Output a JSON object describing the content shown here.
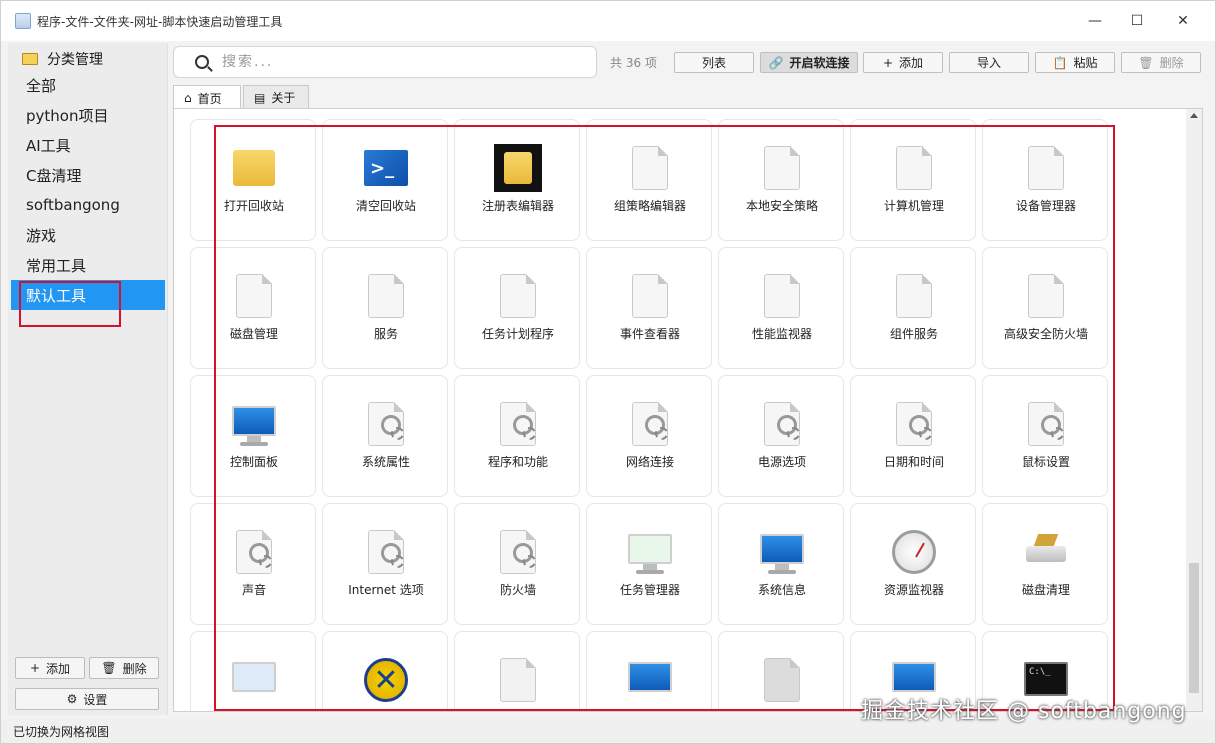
{
  "window": {
    "title": "程序-文件-文件夹-网址-脚本快速启动管理工具"
  },
  "sidebar": {
    "header": "分类管理",
    "items": [
      {
        "label": "全部"
      },
      {
        "label": "python项目"
      },
      {
        "label": "AI工具"
      },
      {
        "label": "C盘清理"
      },
      {
        "label": "softbangong"
      },
      {
        "label": "游戏"
      },
      {
        "label": "常用工具"
      },
      {
        "label": "默认工具",
        "active": true
      }
    ],
    "add_label": "添加",
    "delete_label": "删除",
    "settings_label": "设置"
  },
  "toolbar": {
    "search_placeholder": "搜索...",
    "count": "共 36 项",
    "list_label": "列表",
    "soft_link_label": "开启软连接",
    "add_label": "添加",
    "import_label": "导入",
    "paste_label": "粘贴",
    "delete_label": "删除"
  },
  "tabs": [
    {
      "label": "首页",
      "active": true
    },
    {
      "label": "关于"
    }
  ],
  "items": [
    {
      "label": "打开回收站",
      "icon": "folder-icon"
    },
    {
      "label": "清空回收站",
      "icon": "powershell-icon"
    },
    {
      "label": "注册表编辑器",
      "icon": "folder-dark-icon"
    },
    {
      "label": "组策略编辑器",
      "icon": "document-icon"
    },
    {
      "label": "本地安全策略",
      "icon": "document-icon"
    },
    {
      "label": "计算机管理",
      "icon": "document-icon"
    },
    {
      "label": "设备管理器",
      "icon": "document-icon"
    },
    {
      "label": "磁盘管理",
      "icon": "document-icon"
    },
    {
      "label": "服务",
      "icon": "document-icon"
    },
    {
      "label": "任务计划程序",
      "icon": "document-icon"
    },
    {
      "label": "事件查看器",
      "icon": "document-icon"
    },
    {
      "label": "性能监视器",
      "icon": "document-icon"
    },
    {
      "label": "组件服务",
      "icon": "document-icon"
    },
    {
      "label": "高级安全防火墙",
      "icon": "document-icon"
    },
    {
      "label": "控制面板",
      "icon": "control-panel-icon"
    },
    {
      "label": "系统属性",
      "icon": "settings-doc-icon"
    },
    {
      "label": "程序和功能",
      "icon": "settings-doc-icon"
    },
    {
      "label": "网络连接",
      "icon": "settings-doc-icon"
    },
    {
      "label": "电源选项",
      "icon": "settings-doc-icon"
    },
    {
      "label": "日期和时间",
      "icon": "settings-doc-icon"
    },
    {
      "label": "鼠标设置",
      "icon": "settings-doc-icon"
    },
    {
      "label": "声音",
      "icon": "settings-doc-icon"
    },
    {
      "label": "Internet 选项",
      "icon": "settings-doc-icon"
    },
    {
      "label": "防火墙",
      "icon": "settings-doc-icon"
    },
    {
      "label": "任务管理器",
      "icon": "task-manager-icon"
    },
    {
      "label": "系统信息",
      "icon": "system-info-icon"
    },
    {
      "label": "资源监视器",
      "icon": "gauge-icon"
    },
    {
      "label": "磁盘清理",
      "icon": "disk-cleanup-icon"
    },
    {
      "label": "",
      "icon": "checklist-monitor-icon"
    },
    {
      "label": "",
      "icon": "x-circle-icon"
    },
    {
      "label": "",
      "icon": "calculator-icon"
    },
    {
      "label": "",
      "icon": "keyboard-monitor-icon"
    },
    {
      "label": "",
      "icon": "install-icon"
    },
    {
      "label": "",
      "icon": "restore-monitor-icon"
    },
    {
      "label": "",
      "icon": "command-prompt-icon"
    }
  ],
  "status": "已切换为网格视图",
  "watermark": "掘金技术社区 @ softbangong"
}
